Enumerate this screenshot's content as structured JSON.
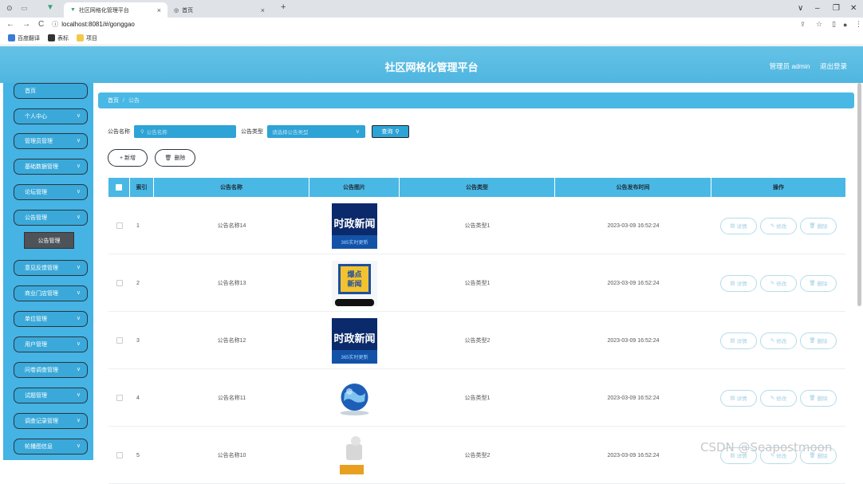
{
  "browser": {
    "tabs": [
      {
        "label": "社区网格化管理平台",
        "close": "×"
      },
      {
        "label": "首页",
        "close": "×"
      }
    ],
    "new_tab": "+",
    "url": "localhost:8081/#/gonggao",
    "bookmarks": [
      {
        "label": "百度翻译",
        "color": "#3a7bd5"
      },
      {
        "label": "表标",
        "color": "#333333"
      },
      {
        "label": "项目",
        "color": "#f2c94c"
      }
    ],
    "window_controls": [
      "∨",
      "–",
      "❐",
      "✕"
    ]
  },
  "header": {
    "title": "社区网格化管理平台",
    "user": "管理员 admin",
    "logout": "退出登录"
  },
  "sidebar": {
    "items": [
      {
        "label": "首页",
        "chevron": false
      },
      {
        "label": "个人中心",
        "chevron": true
      },
      {
        "label": "管理员管理",
        "chevron": true
      },
      {
        "label": "基础数据管理",
        "chevron": true
      },
      {
        "label": "论坛管理",
        "chevron": true
      },
      {
        "label": "公告管理",
        "chevron": true
      },
      {
        "label": "意见反馈管理",
        "chevron": true
      },
      {
        "label": "商业门店管理",
        "chevron": true
      },
      {
        "label": "单位管理",
        "chevron": true
      },
      {
        "label": "用户管理",
        "chevron": true
      },
      {
        "label": "问卷调查管理",
        "chevron": true
      },
      {
        "label": "试题管理",
        "chevron": true
      },
      {
        "label": "调查记录管理",
        "chevron": true
      },
      {
        "label": "轮播图信息",
        "chevron": true
      }
    ],
    "active_submenu": "公告管理"
  },
  "breadcrumb": {
    "home": "首页",
    "separator": "/",
    "current": "公告"
  },
  "search": {
    "name_label": "公告名称",
    "name_placeholder": "公告名称",
    "type_label": "公告类型",
    "type_placeholder": "请选择公告类型",
    "query_button": "查询"
  },
  "actions": {
    "add": "+ 新增",
    "delete": "删除"
  },
  "table": {
    "headers": [
      "索引",
      "公告名称",
      "公告图片",
      "公告类型",
      "公告发布时间",
      "操作"
    ],
    "rows": [
      {
        "index": "1",
        "name": "公告名称14",
        "image": "news-blue",
        "type": "公告类型1",
        "time": "2023-03-09 16:52:24"
      },
      {
        "index": "2",
        "name": "公告名称13",
        "image": "hot-news",
        "type": "公告类型1",
        "time": "2023-03-09 16:52:24"
      },
      {
        "index": "3",
        "name": "公告名称12",
        "image": "news-blue",
        "type": "公告类型2",
        "time": "2023-03-09 16:52:24"
      },
      {
        "index": "4",
        "name": "公告名称11",
        "image": "globe",
        "type": "公告类型1",
        "time": "2023-03-09 16:52:24"
      },
      {
        "index": "5",
        "name": "公告名称10",
        "image": "figure",
        "type": "公告类型2",
        "time": "2023-03-09 16:52:24"
      }
    ],
    "op_buttons": {
      "detail": "详情",
      "edit": "修改",
      "delete": "删除"
    },
    "thumb_text": {
      "news_title": "时政新闻",
      "news_sub": "365实时更新",
      "hot_line1": "爆点",
      "hot_line2": "新闻"
    }
  },
  "watermark": "CSDN @Seapostmoon",
  "colors": {
    "accent": "#4ab8e4",
    "sidebar": "#45b3e3",
    "header": "#5fbfe5"
  }
}
